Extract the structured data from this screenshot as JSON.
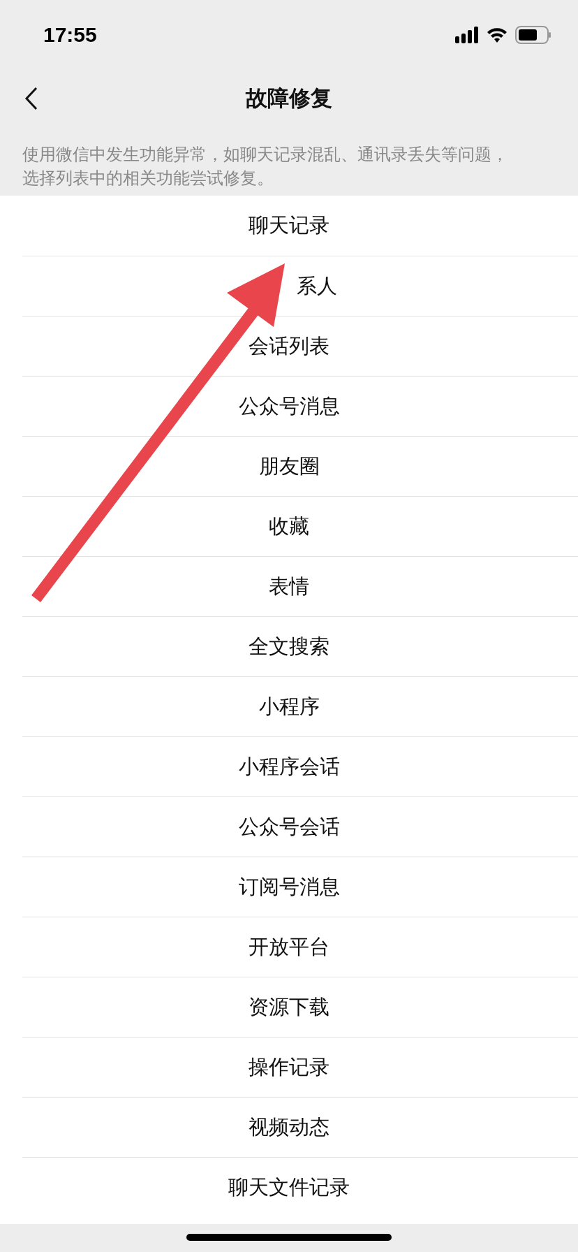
{
  "status_bar": {
    "time": "17:55"
  },
  "nav": {
    "title": "故障修复"
  },
  "description": "使用微信中发生功能异常，如聊天记录混乱、通讯录丢失等问题，选择列表中的相关功能尝试修复。",
  "items": [
    "聊天记录",
    "系人",
    "会话列表",
    "公众号消息",
    "朋友圈",
    "收藏",
    "表情",
    "全文搜索",
    "小程序",
    "小程序会话",
    "公众号会话",
    "订阅号消息",
    "开放平台",
    "资源下载",
    "操作记录",
    "视频动态",
    "聊天文件记录"
  ]
}
